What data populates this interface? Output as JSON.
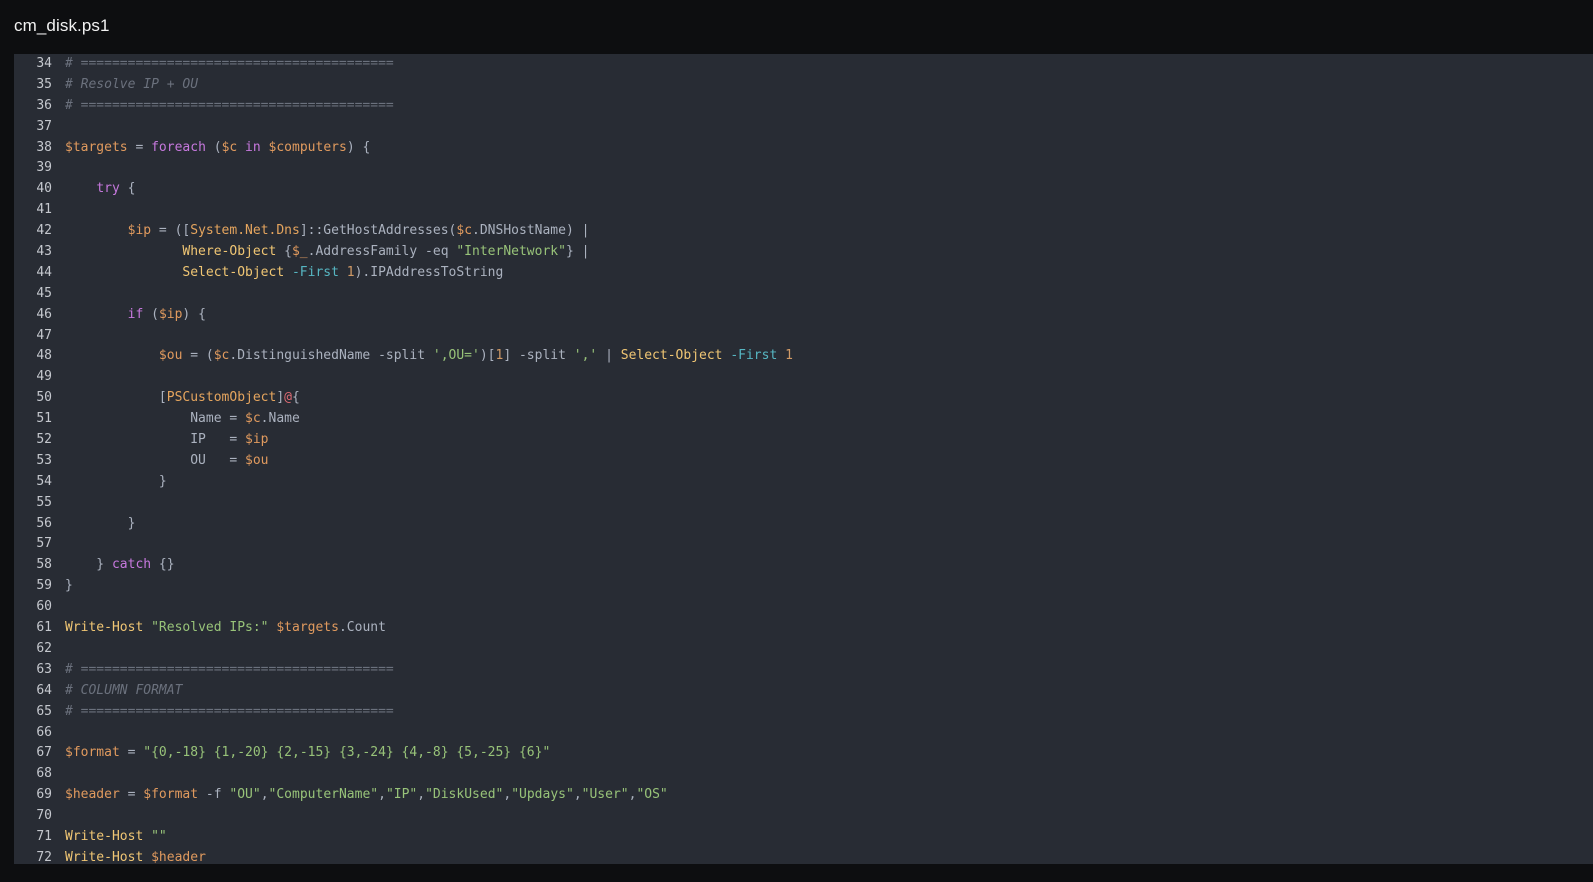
{
  "file_title": "cm_disk.ps1",
  "colors": {
    "background": "#0d0e10",
    "editor_bg": "#282c34",
    "comment": "#6b717d",
    "variable": "#e09a5e",
    "keyword": "#c678dd",
    "type": "#e5a55e",
    "cmdlet": "#f0c674",
    "string": "#98c379",
    "parameter": "#56b6c2",
    "number": "#d19a66"
  },
  "lines": [
    {
      "n": "34",
      "tokens": [
        [
          "comment",
          "# ========================================"
        ]
      ]
    },
    {
      "n": "35",
      "tokens": [
        [
          "comment",
          "# Resolve IP + OU"
        ]
      ]
    },
    {
      "n": "36",
      "tokens": [
        [
          "comment",
          "# ========================================"
        ]
      ]
    },
    {
      "n": "37",
      "tokens": []
    },
    {
      "n": "38",
      "tokens": [
        [
          "var",
          "$targets"
        ],
        [
          "plain",
          " = "
        ],
        [
          "kw",
          "foreach"
        ],
        [
          "plain",
          " ("
        ],
        [
          "var",
          "$c"
        ],
        [
          "plain",
          " "
        ],
        [
          "kw",
          "in"
        ],
        [
          "plain",
          " "
        ],
        [
          "var",
          "$computers"
        ],
        [
          "plain",
          ") {"
        ]
      ]
    },
    {
      "n": "39",
      "tokens": []
    },
    {
      "n": "40",
      "tokens": [
        [
          "plain",
          "    "
        ],
        [
          "kw",
          "try"
        ],
        [
          "plain",
          " {"
        ]
      ]
    },
    {
      "n": "41",
      "tokens": []
    },
    {
      "n": "42",
      "tokens": [
        [
          "plain",
          "        "
        ],
        [
          "var",
          "$ip"
        ],
        [
          "plain",
          " = (["
        ],
        [
          "type",
          "System.Net.Dns"
        ],
        [
          "plain",
          "]::GetHostAddresses("
        ],
        [
          "var",
          "$c"
        ],
        [
          "plain",
          ".DNSHostName) |"
        ]
      ]
    },
    {
      "n": "43",
      "tokens": [
        [
          "plain",
          "               "
        ],
        [
          "cmd",
          "Where-Object"
        ],
        [
          "plain",
          " {"
        ],
        [
          "var",
          "$_"
        ],
        [
          "plain",
          ".AddressFamily -eq "
        ],
        [
          "str",
          "\"InterNetwork\""
        ],
        [
          "plain",
          "} |"
        ]
      ]
    },
    {
      "n": "44",
      "tokens": [
        [
          "plain",
          "               "
        ],
        [
          "cmd",
          "Select-Object"
        ],
        [
          "plain",
          " "
        ],
        [
          "param",
          "-First"
        ],
        [
          "plain",
          " "
        ],
        [
          "num",
          "1"
        ],
        [
          "plain",
          ").IPAddressToString"
        ]
      ]
    },
    {
      "n": "45",
      "tokens": []
    },
    {
      "n": "46",
      "tokens": [
        [
          "plain",
          "        "
        ],
        [
          "kw",
          "if"
        ],
        [
          "plain",
          " ("
        ],
        [
          "var",
          "$ip"
        ],
        [
          "plain",
          ") {"
        ]
      ]
    },
    {
      "n": "47",
      "tokens": []
    },
    {
      "n": "48",
      "tokens": [
        [
          "plain",
          "            "
        ],
        [
          "var",
          "$ou"
        ],
        [
          "plain",
          " = ("
        ],
        [
          "var",
          "$c"
        ],
        [
          "plain",
          ".DistinguishedName -split "
        ],
        [
          "str",
          "',OU='"
        ],
        [
          "plain",
          ")["
        ],
        [
          "num",
          "1"
        ],
        [
          "plain",
          "] -split "
        ],
        [
          "str",
          "','"
        ],
        [
          "plain",
          " | "
        ],
        [
          "cmd",
          "Select-Object"
        ],
        [
          "plain",
          " "
        ],
        [
          "param",
          "-First"
        ],
        [
          "plain",
          " "
        ],
        [
          "num",
          "1"
        ]
      ]
    },
    {
      "n": "49",
      "tokens": []
    },
    {
      "n": "50",
      "tokens": [
        [
          "plain",
          "            ["
        ],
        [
          "type",
          "PSCustomObject"
        ],
        [
          "plain",
          "]"
        ],
        [
          "op",
          "@"
        ],
        [
          "plain",
          "{"
        ]
      ]
    },
    {
      "n": "51",
      "tokens": [
        [
          "plain",
          "                Name = "
        ],
        [
          "var",
          "$c"
        ],
        [
          "plain",
          ".Name"
        ]
      ]
    },
    {
      "n": "52",
      "tokens": [
        [
          "plain",
          "                IP   = "
        ],
        [
          "var",
          "$ip"
        ]
      ]
    },
    {
      "n": "53",
      "tokens": [
        [
          "plain",
          "                OU   = "
        ],
        [
          "var",
          "$ou"
        ]
      ]
    },
    {
      "n": "54",
      "tokens": [
        [
          "plain",
          "            }"
        ]
      ]
    },
    {
      "n": "55",
      "tokens": []
    },
    {
      "n": "56",
      "tokens": [
        [
          "plain",
          "        }"
        ]
      ]
    },
    {
      "n": "57",
      "tokens": []
    },
    {
      "n": "58",
      "tokens": [
        [
          "plain",
          "    } "
        ],
        [
          "kw",
          "catch"
        ],
        [
          "plain",
          " {}"
        ]
      ]
    },
    {
      "n": "59",
      "tokens": [
        [
          "plain",
          "}"
        ]
      ]
    },
    {
      "n": "60",
      "tokens": []
    },
    {
      "n": "61",
      "tokens": [
        [
          "cmd",
          "Write-Host"
        ],
        [
          "plain",
          " "
        ],
        [
          "str",
          "\"Resolved IPs:\""
        ],
        [
          "plain",
          " "
        ],
        [
          "var",
          "$targets"
        ],
        [
          "plain",
          ".Count"
        ]
      ]
    },
    {
      "n": "62",
      "tokens": []
    },
    {
      "n": "63",
      "tokens": [
        [
          "comment",
          "# ========================================"
        ]
      ]
    },
    {
      "n": "64",
      "tokens": [
        [
          "comment",
          "# COLUMN FORMAT"
        ]
      ]
    },
    {
      "n": "65",
      "tokens": [
        [
          "comment",
          "# ========================================"
        ]
      ]
    },
    {
      "n": "66",
      "tokens": []
    },
    {
      "n": "67",
      "tokens": [
        [
          "var",
          "$format"
        ],
        [
          "plain",
          " = "
        ],
        [
          "str",
          "\"{0,-18} {1,-20} {2,-15} {3,-24} {4,-8} {5,-25} {6}\""
        ]
      ]
    },
    {
      "n": "68",
      "tokens": []
    },
    {
      "n": "69",
      "tokens": [
        [
          "var",
          "$header"
        ],
        [
          "plain",
          " = "
        ],
        [
          "var",
          "$format"
        ],
        [
          "plain",
          " -f "
        ],
        [
          "str",
          "\"OU\""
        ],
        [
          "plain",
          ","
        ],
        [
          "str",
          "\"ComputerName\""
        ],
        [
          "plain",
          ","
        ],
        [
          "str",
          "\"IP\""
        ],
        [
          "plain",
          ","
        ],
        [
          "str",
          "\"DiskUsed\""
        ],
        [
          "plain",
          ","
        ],
        [
          "str",
          "\"Updays\""
        ],
        [
          "plain",
          ","
        ],
        [
          "str",
          "\"User\""
        ],
        [
          "plain",
          ","
        ],
        [
          "str",
          "\"OS\""
        ]
      ]
    },
    {
      "n": "70",
      "tokens": []
    },
    {
      "n": "71",
      "tokens": [
        [
          "cmd",
          "Write-Host"
        ],
        [
          "plain",
          " "
        ],
        [
          "str",
          "\"\""
        ]
      ]
    },
    {
      "n": "72",
      "tokens": [
        [
          "cmd",
          "Write-Host"
        ],
        [
          "plain",
          " "
        ],
        [
          "var",
          "$header"
        ]
      ]
    }
  ]
}
